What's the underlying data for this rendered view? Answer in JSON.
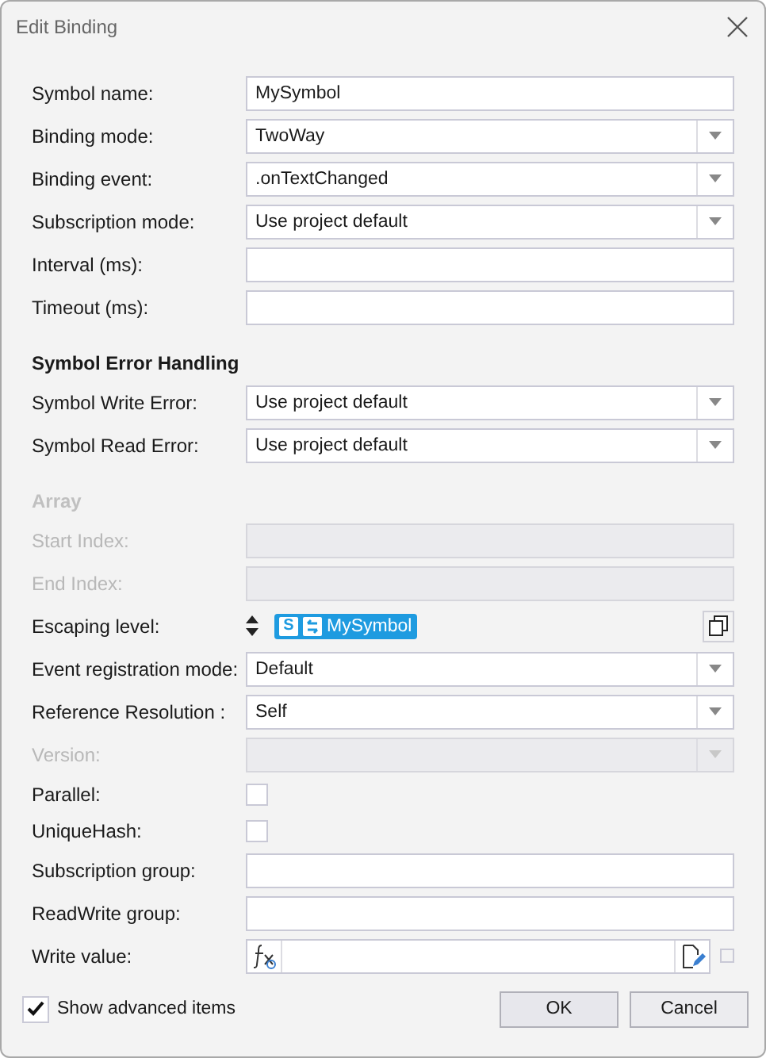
{
  "window": {
    "title": "Edit Binding"
  },
  "fields": [
    {
      "kind": "text",
      "label": "Symbol name:",
      "value": "MySymbol",
      "disabled": false
    },
    {
      "kind": "combo",
      "label": "Binding mode:",
      "value": "TwoWay",
      "disabled": false
    },
    {
      "kind": "combo",
      "label": "Binding event:",
      "value": ".onTextChanged",
      "disabled": false
    },
    {
      "kind": "combo",
      "label": "Subscription mode:",
      "value": "Use project default",
      "disabled": false
    },
    {
      "kind": "text",
      "label": "Interval (ms):",
      "disabled": false
    },
    {
      "kind": "text",
      "label": "Timeout (ms):",
      "disabled": false
    },
    {
      "kind": "header",
      "label": "Symbol Error Handling",
      "disabled": false
    },
    {
      "kind": "combo",
      "label": "Symbol Write Error:",
      "value": "Use project default",
      "disabled": false
    },
    {
      "kind": "combo",
      "label": "Symbol Read Error:",
      "value": "Use project default",
      "disabled": false
    },
    {
      "kind": "header",
      "label": "Array",
      "disabled": true
    },
    {
      "kind": "text",
      "label": "Start Index:",
      "disabled": true
    },
    {
      "kind": "text",
      "label": "End Index:",
      "disabled": true
    },
    {
      "kind": "escaping",
      "label": "Escaping level:",
      "badge": "S",
      "value": "MySymbol",
      "disabled": false
    },
    {
      "kind": "combo",
      "label": "Event registration mode:",
      "value": "Default",
      "disabled": false
    },
    {
      "kind": "combo",
      "label": "Reference Resolution :",
      "value": "Self",
      "disabled": false
    },
    {
      "kind": "combo",
      "label": "Version:",
      "disabled": true
    },
    {
      "kind": "checkbox",
      "label": "Parallel:",
      "checked": false,
      "disabled": false
    },
    {
      "kind": "checkbox",
      "label": "UniqueHash:",
      "checked": false,
      "disabled": false
    },
    {
      "kind": "text",
      "label": "Subscription group:",
      "disabled": false
    },
    {
      "kind": "text",
      "label": "ReadWrite group:",
      "disabled": false
    },
    {
      "kind": "formula",
      "label": "Write value:",
      "checked": false,
      "disabled": false
    }
  ],
  "show_advanced": {
    "label": "Show advanced items",
    "checked": true
  },
  "buttons": [
    "OK",
    "Cancel"
  ]
}
